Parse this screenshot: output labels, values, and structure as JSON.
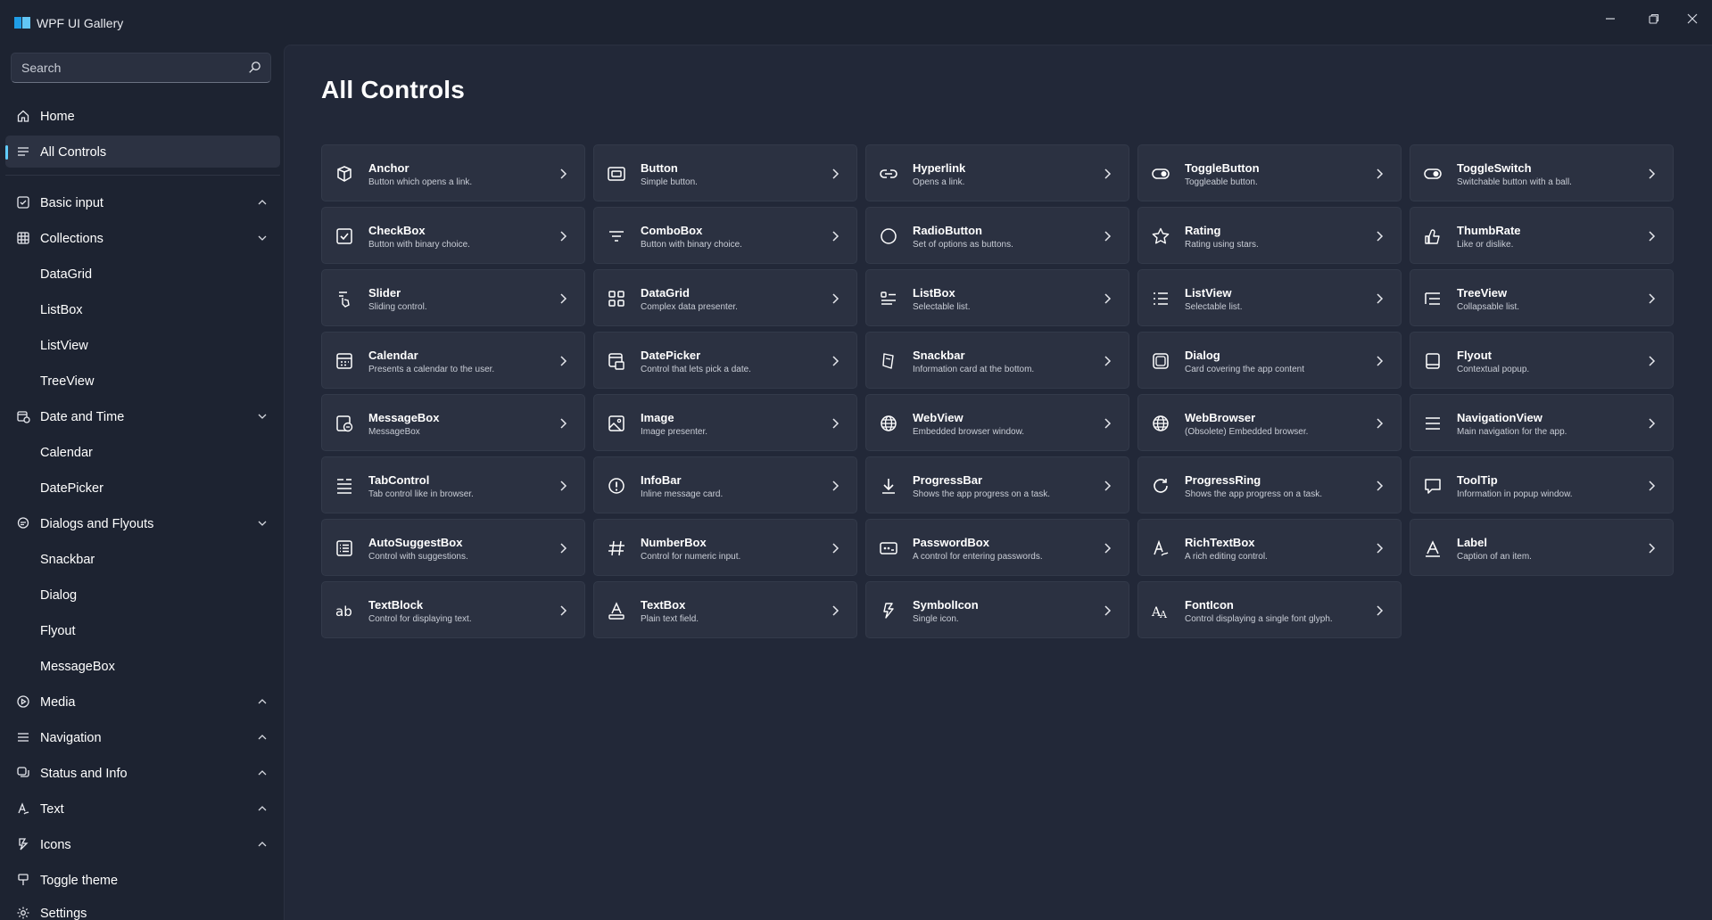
{
  "window": {
    "title": "WPF UI Gallery"
  },
  "search": {
    "placeholder": "Search"
  },
  "nav": {
    "home": "Home",
    "all_controls": "All Controls",
    "basic_input": "Basic input",
    "collections": "Collections",
    "datagrid": "DataGrid",
    "listbox": "ListBox",
    "listview": "ListView",
    "treeview": "TreeView",
    "date_and_time": "Date and Time",
    "calendar": "Calendar",
    "datepicker": "DatePicker",
    "dialogs_and_flyouts": "Dialogs and Flyouts",
    "snackbar": "Snackbar",
    "dialog": "Dialog",
    "flyout": "Flyout",
    "messagebox": "MessageBox",
    "media": "Media",
    "navigation": "Navigation",
    "status_and_info": "Status and Info",
    "text": "Text",
    "icons": "Icons",
    "toggle_theme": "Toggle theme",
    "settings": "Settings"
  },
  "page": {
    "title": "All Controls"
  },
  "cards": [
    {
      "title": "Anchor",
      "desc": "Button which opens a link.",
      "icon": "anchor-icon"
    },
    {
      "title": "Button",
      "desc": "Simple button.",
      "icon": "button-icon"
    },
    {
      "title": "Hyperlink",
      "desc": "Opens a link.",
      "icon": "link-icon"
    },
    {
      "title": "ToggleButton",
      "desc": "Toggleable button.",
      "icon": "toggle-icon"
    },
    {
      "title": "ToggleSwitch",
      "desc": "Switchable button with a ball.",
      "icon": "toggle-icon"
    },
    {
      "title": "CheckBox",
      "desc": "Button with binary choice.",
      "icon": "checkbox-icon"
    },
    {
      "title": "ComboBox",
      "desc": "Button with binary choice.",
      "icon": "filter-icon"
    },
    {
      "title": "RadioButton",
      "desc": "Set of options as buttons.",
      "icon": "radio-icon"
    },
    {
      "title": "Rating",
      "desc": "Rating using stars.",
      "icon": "star-icon"
    },
    {
      "title": "ThumbRate",
      "desc": "Like or dislike.",
      "icon": "thumb-icon"
    },
    {
      "title": "Slider",
      "desc": "Sliding control.",
      "icon": "slider-icon"
    },
    {
      "title": "DataGrid",
      "desc": "Complex data presenter.",
      "icon": "grid-icon"
    },
    {
      "title": "ListBox",
      "desc": "Selectable list.",
      "icon": "listbox-icon"
    },
    {
      "title": "ListView",
      "desc": "Selectable list.",
      "icon": "list-icon"
    },
    {
      "title": "TreeView",
      "desc": "Collapsable list.",
      "icon": "tree-icon"
    },
    {
      "title": "Calendar",
      "desc": "Presents a calendar to the user.",
      "icon": "calendar-icon"
    },
    {
      "title": "DatePicker",
      "desc": "Control that lets pick a date.",
      "icon": "datepicker-icon"
    },
    {
      "title": "Snackbar",
      "desc": "Information card at the bottom.",
      "icon": "snackbar-icon"
    },
    {
      "title": "Dialog",
      "desc": "Card covering the app content",
      "icon": "dialog-icon"
    },
    {
      "title": "Flyout",
      "desc": "Contextual popup.",
      "icon": "flyout-icon"
    },
    {
      "title": "MessageBox",
      "desc": "MessageBox",
      "icon": "messagebox-icon"
    },
    {
      "title": "Image",
      "desc": "Image presenter.",
      "icon": "image-icon"
    },
    {
      "title": "WebView",
      "desc": "Embedded browser window.",
      "icon": "globe-icon"
    },
    {
      "title": "WebBrowser",
      "desc": "(Obsolete) Embedded browser.",
      "icon": "globe-icon"
    },
    {
      "title": "NavigationView",
      "desc": "Main navigation for the app.",
      "icon": "menu-icon"
    },
    {
      "title": "TabControl",
      "desc": "Tab control like in browser.",
      "icon": "tabs-icon"
    },
    {
      "title": "InfoBar",
      "desc": "Inline message card.",
      "icon": "info-icon"
    },
    {
      "title": "ProgressBar",
      "desc": "Shows the app progress on a task.",
      "icon": "download-icon"
    },
    {
      "title": "ProgressRing",
      "desc": "Shows the app progress on a task.",
      "icon": "refresh-icon"
    },
    {
      "title": "ToolTip",
      "desc": "Information in popup window.",
      "icon": "comment-icon"
    },
    {
      "title": "AutoSuggestBox",
      "desc": "Control with suggestions.",
      "icon": "textbox-list-icon"
    },
    {
      "title": "NumberBox",
      "desc": "Control for numeric input.",
      "icon": "hash-icon"
    },
    {
      "title": "PasswordBox",
      "desc": "A control for entering passwords.",
      "icon": "password-icon"
    },
    {
      "title": "RichTextBox",
      "desc": "A rich editing control.",
      "icon": "pen-icon"
    },
    {
      "title": "Label",
      "desc": "Caption of an item.",
      "icon": "text-a-icon"
    },
    {
      "title": "TextBlock",
      "desc": "Control for displaying text.",
      "icon": "ab-icon"
    },
    {
      "title": "TextBox",
      "desc": "Plain text field.",
      "icon": "textbox-icon"
    },
    {
      "title": "SymbolIcon",
      "desc": "Single icon.",
      "icon": "symbol-icon"
    },
    {
      "title": "FontIcon",
      "desc": "Control displaying a single font glyph.",
      "icon": "font-icon"
    }
  ]
}
